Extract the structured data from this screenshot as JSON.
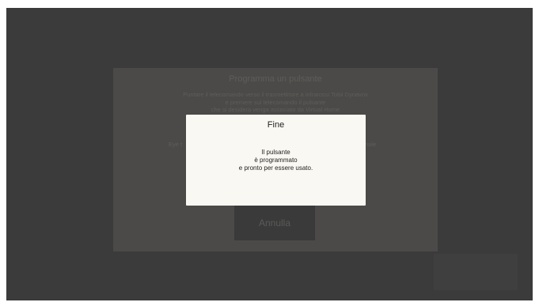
{
  "background": {
    "title": "Programma un pulsante",
    "instructions": [
      "Puntare il telecomando verso il trasmettitore a infrarossi Tobii Dynavox",
      "e premere sul telecomando il pulsante",
      "che si desidera venga associato da Virtual Home"
    ],
    "side_left": "Eye t",
    "side_right": "nale",
    "cancel_label": "Annulla"
  },
  "dialog": {
    "title": "Fine",
    "message_lines": [
      "Il pulsante",
      "è programmato",
      "e pronto per essere usato."
    ]
  }
}
